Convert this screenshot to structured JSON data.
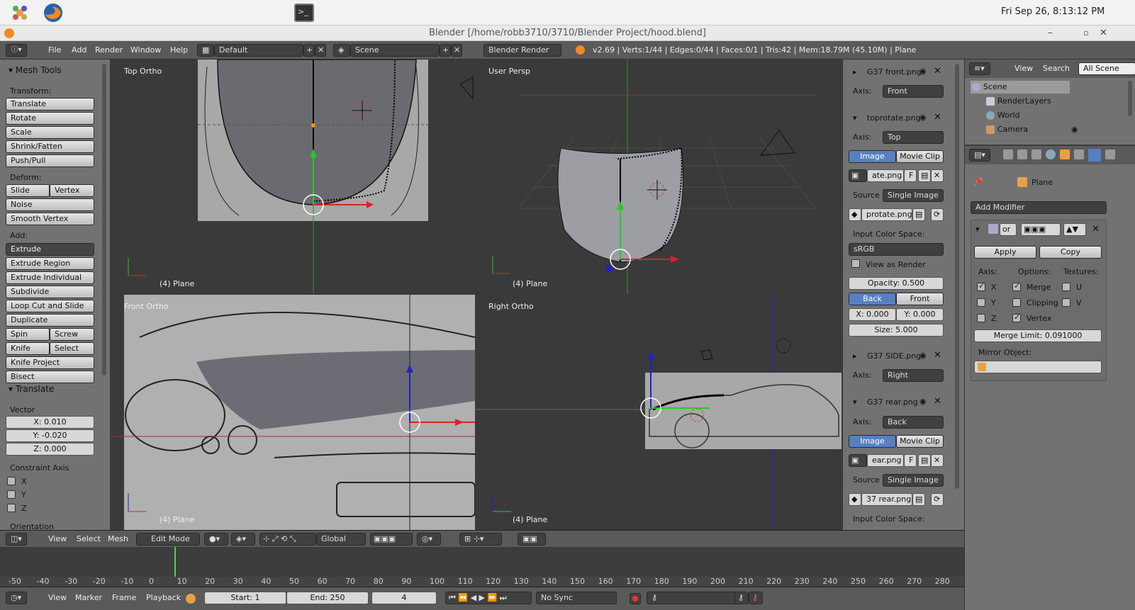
{
  "system": {
    "clock": "Fri Sep 26,  8:13:12 PM"
  },
  "window": {
    "title": "Blender [/home/robb3710/3710/Blender Project/hood.blend]"
  },
  "infobar": {
    "menus": [
      "File",
      "Add",
      "Render",
      "Window",
      "Help"
    ],
    "layout": "Default",
    "scene": "Scene",
    "engine": "Blender Render",
    "stats": "v2.69 | Verts:1/44 | Edges:0/44 | Faces:0/1 | Tris:42 | Mem:18.79M (45.10M) | Plane"
  },
  "toolshelf": {
    "header": "Mesh Tools",
    "transform_label": "Transform:",
    "transform": [
      "Translate",
      "Rotate",
      "Scale",
      "Shrink/Fatten",
      "Push/Pull"
    ],
    "deform_label": "Deform:",
    "slide_edge": "Slide Edge",
    "vertex": "Vertex",
    "noise": "Noise",
    "smooth_vertex": "Smooth Vertex",
    "add_label": "Add:",
    "extrude": "Extrude",
    "add": [
      "Extrude Region",
      "Extrude Individual",
      "Subdivide",
      "Loop Cut and Slide",
      "Duplicate"
    ],
    "spin": "Spin",
    "screw": "Screw",
    "knife": "Knife",
    "select": "Select",
    "knife_project": "Knife Project",
    "bisect": "Bisect",
    "op_header": "Translate",
    "vector_label": "Vector",
    "vx": "X: 0.010",
    "vy": "Y: -0.020",
    "vz": "Z: 0.000",
    "constraint_label": "Constraint Axis",
    "cx": "X",
    "cy": "Y",
    "cz": "Z",
    "orientation_label": "Orientation"
  },
  "viewports": {
    "top": {
      "title": "Top Ortho",
      "obj": "(4) Plane"
    },
    "persp": {
      "title": "User Persp",
      "obj": "(4) Plane"
    },
    "front": {
      "title": "Front Ortho",
      "obj": "(4) Plane"
    },
    "right": {
      "title": "Right Ortho",
      "obj": "(4) Plane"
    }
  },
  "bgimages": {
    "front_name": "G37 front.png",
    "front_axis_label": "Axis:",
    "front_axis": "Front",
    "top_name": "toprotate.png",
    "top_axis_label": "Axis:",
    "top_axis": "Top",
    "image_tab": "Image",
    "movie_tab": "Movie Clip",
    "top_file": "ate.png",
    "f_letter": "F",
    "source_label": "Source",
    "source": "Single Image",
    "top_path": "protate.png",
    "ics_label": "Input Color Space:",
    "ics": "sRGB",
    "view_as_render": "View as Render",
    "opacity": "Opacity: 0.500",
    "back": "Back",
    "front": "Front",
    "ox": "X: 0.000",
    "oy": "Y: 0.000",
    "size": "Size: 5.000",
    "side_name": "G37 SIDE.png",
    "side_axis_label": "Axis:",
    "side_axis": "Right",
    "rear_name": "G37 rear.png",
    "rear_axis_label": "Axis:",
    "rear_axis": "Back",
    "image_tab2": "Image",
    "movie_tab2": "Movie Clip",
    "rear_file": "ear.png",
    "f_letter2": "F",
    "source_label2": "Source",
    "source2": "Single Image",
    "rear_path": "37 rear.png",
    "ics_label2": "Input Color Space:"
  },
  "outliner": {
    "view": "View",
    "search": "Search",
    "all_scenes": "All Scene",
    "items": [
      "Scene",
      "RenderLayers",
      "World",
      "Camera"
    ]
  },
  "properties": {
    "object": "Plane",
    "add_modifier": "Add Modifier",
    "mod_name": "or",
    "apply": "Apply",
    "copy": "Copy",
    "axis_label": "Axis:",
    "options_label": "Options:",
    "textures_label": "Textures:",
    "x": "X",
    "y": "Y",
    "z": "Z",
    "merge": "Merge",
    "clipping": "Clipping",
    "vertex_opt": "Vertex",
    "u": "U",
    "v": "V",
    "merge_limit": "Merge Limit: 0.091000",
    "mirror_object": "Mirror Object:"
  },
  "vphead": {
    "view": "View",
    "select": "Select",
    "mesh": "Mesh",
    "mode": "Edit Mode",
    "orientation": "Global"
  },
  "ruler": [
    "-50",
    "-40",
    "-30",
    "-20",
    "-10",
    "0",
    "10",
    "20",
    "30",
    "40",
    "50",
    "60",
    "70",
    "80",
    "90",
    "100",
    "110",
    "120",
    "130",
    "140",
    "150",
    "160",
    "170",
    "180",
    "190",
    "200",
    "210",
    "220",
    "230",
    "240",
    "250",
    "260",
    "270",
    "280"
  ],
  "timeline": {
    "view": "View",
    "marker": "Marker",
    "frame": "Frame",
    "playback": "Playback",
    "start": "Start: 1",
    "end": "End: 250",
    "current": "4",
    "sync": "No Sync"
  },
  "colors": {
    "accent_blue": "#5680c2",
    "panel": "#727272",
    "viewport": "#3a3a3a"
  }
}
